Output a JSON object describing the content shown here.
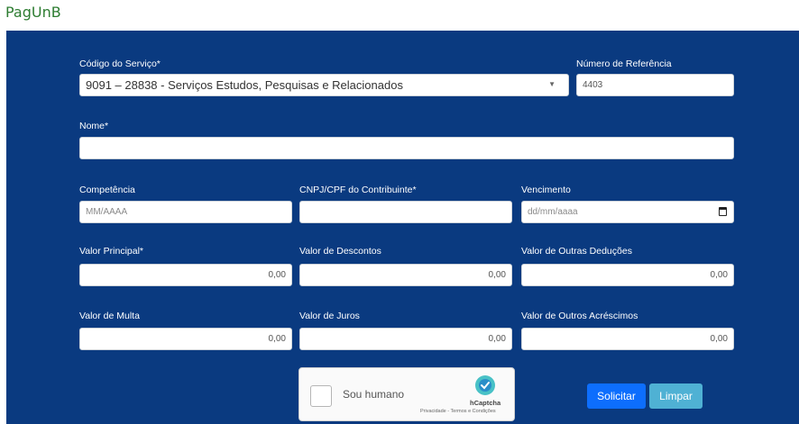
{
  "app": {
    "title": "PagUnB"
  },
  "form": {
    "service": {
      "label": "Código do Serviço*",
      "value": "9091 – 28838 - Serviços Estudos, Pesquisas e Relacionados"
    },
    "reference": {
      "label": "Número de Referência",
      "value": "4403"
    },
    "name": {
      "label": "Nome*",
      "value": ""
    },
    "competencia": {
      "label": "Competência",
      "placeholder": "MM/AAAA"
    },
    "cnpj": {
      "label": "CNPJ/CPF do Contribuinte*",
      "value": ""
    },
    "vencimento": {
      "label": "Vencimento",
      "placeholder": "dd/mm/aaaa"
    },
    "valor_principal": {
      "label": "Valor Principal*",
      "value": "0,00"
    },
    "valor_descontos": {
      "label": "Valor de Descontos",
      "value": "0,00"
    },
    "valor_outras_deducoes": {
      "label": "Valor de Outras Deduções",
      "value": "0,00"
    },
    "valor_multa": {
      "label": "Valor de Multa",
      "value": "0,00"
    },
    "valor_juros": {
      "label": "Valor de Juros",
      "value": "0,00"
    },
    "valor_outros_acrescimos": {
      "label": "Valor de Outros Acréscimos",
      "value": "0,00"
    }
  },
  "captcha": {
    "label": "Sou humano",
    "brand": "hCaptcha",
    "links": "Privacidade - Termos e Condições"
  },
  "buttons": {
    "submit": "Solicitar",
    "clear": "Limpar"
  },
  "colors": {
    "panel": "#0a3a80",
    "primary": "#0d6efd",
    "info": "#4fb1d4",
    "title": "#2e7d32"
  }
}
